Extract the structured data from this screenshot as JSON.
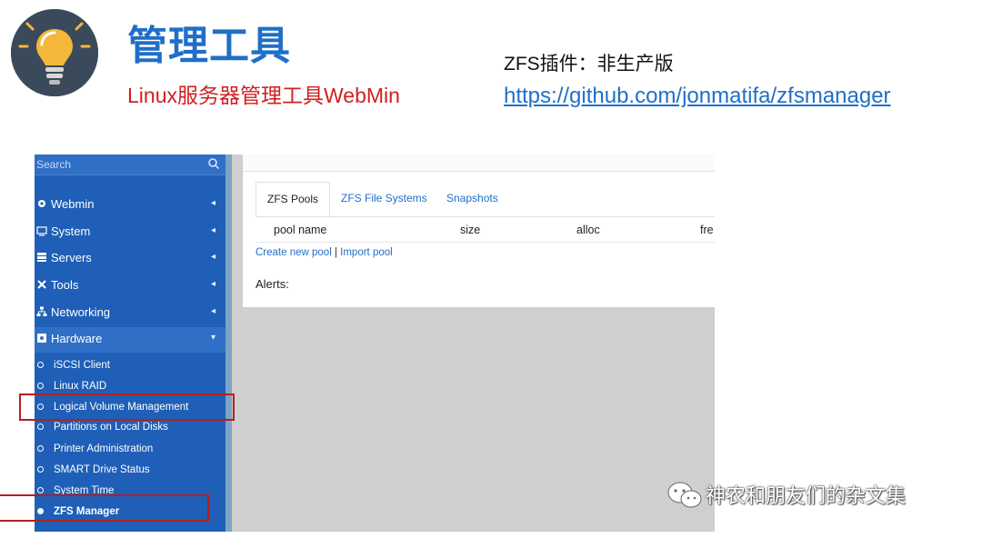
{
  "slide": {
    "title": "管理工具",
    "subtitle": "Linux服务器管理工具WebMin",
    "plugin_note": "ZFS插件：非生产版",
    "plugin_link": "https://github.com/jonmatifa/zfsmanager"
  },
  "colors": {
    "title_blue": "#1f6fc8",
    "subtitle_red": "#d02020",
    "sidebar_blue": "#1f5fb7",
    "highlight_red": "#b32020"
  },
  "sidebar": {
    "search_placeholder": "Search",
    "menu": [
      {
        "label": "Webmin",
        "icon": "gear-icon"
      },
      {
        "label": "System",
        "icon": "monitor-icon"
      },
      {
        "label": "Servers",
        "icon": "server-icon"
      },
      {
        "label": "Tools",
        "icon": "wrench-icon"
      },
      {
        "label": "Networking",
        "icon": "network-icon"
      },
      {
        "label": "Hardware",
        "icon": "hardware-icon"
      }
    ],
    "hardware_items": [
      {
        "label": "iSCSI Client"
      },
      {
        "label": "Linux RAID"
      },
      {
        "label": "Logical Volume Management"
      },
      {
        "label": "Partitions on Local Disks"
      },
      {
        "label": "Printer Administration"
      },
      {
        "label": "SMART Drive Status"
      },
      {
        "label": "System Time"
      },
      {
        "label": "ZFS Manager"
      }
    ]
  },
  "main": {
    "tabs": [
      {
        "label": "ZFS Pools"
      },
      {
        "label": "ZFS File Systems"
      },
      {
        "label": "Snapshots"
      }
    ],
    "columns": [
      "pool name",
      "size",
      "alloc",
      "fre"
    ],
    "links": {
      "create": "Create new pool",
      "separator": "|",
      "import": "Import pool"
    },
    "alerts_label": "Alerts:"
  },
  "watermark": "神农和朋友们的杂文集"
}
